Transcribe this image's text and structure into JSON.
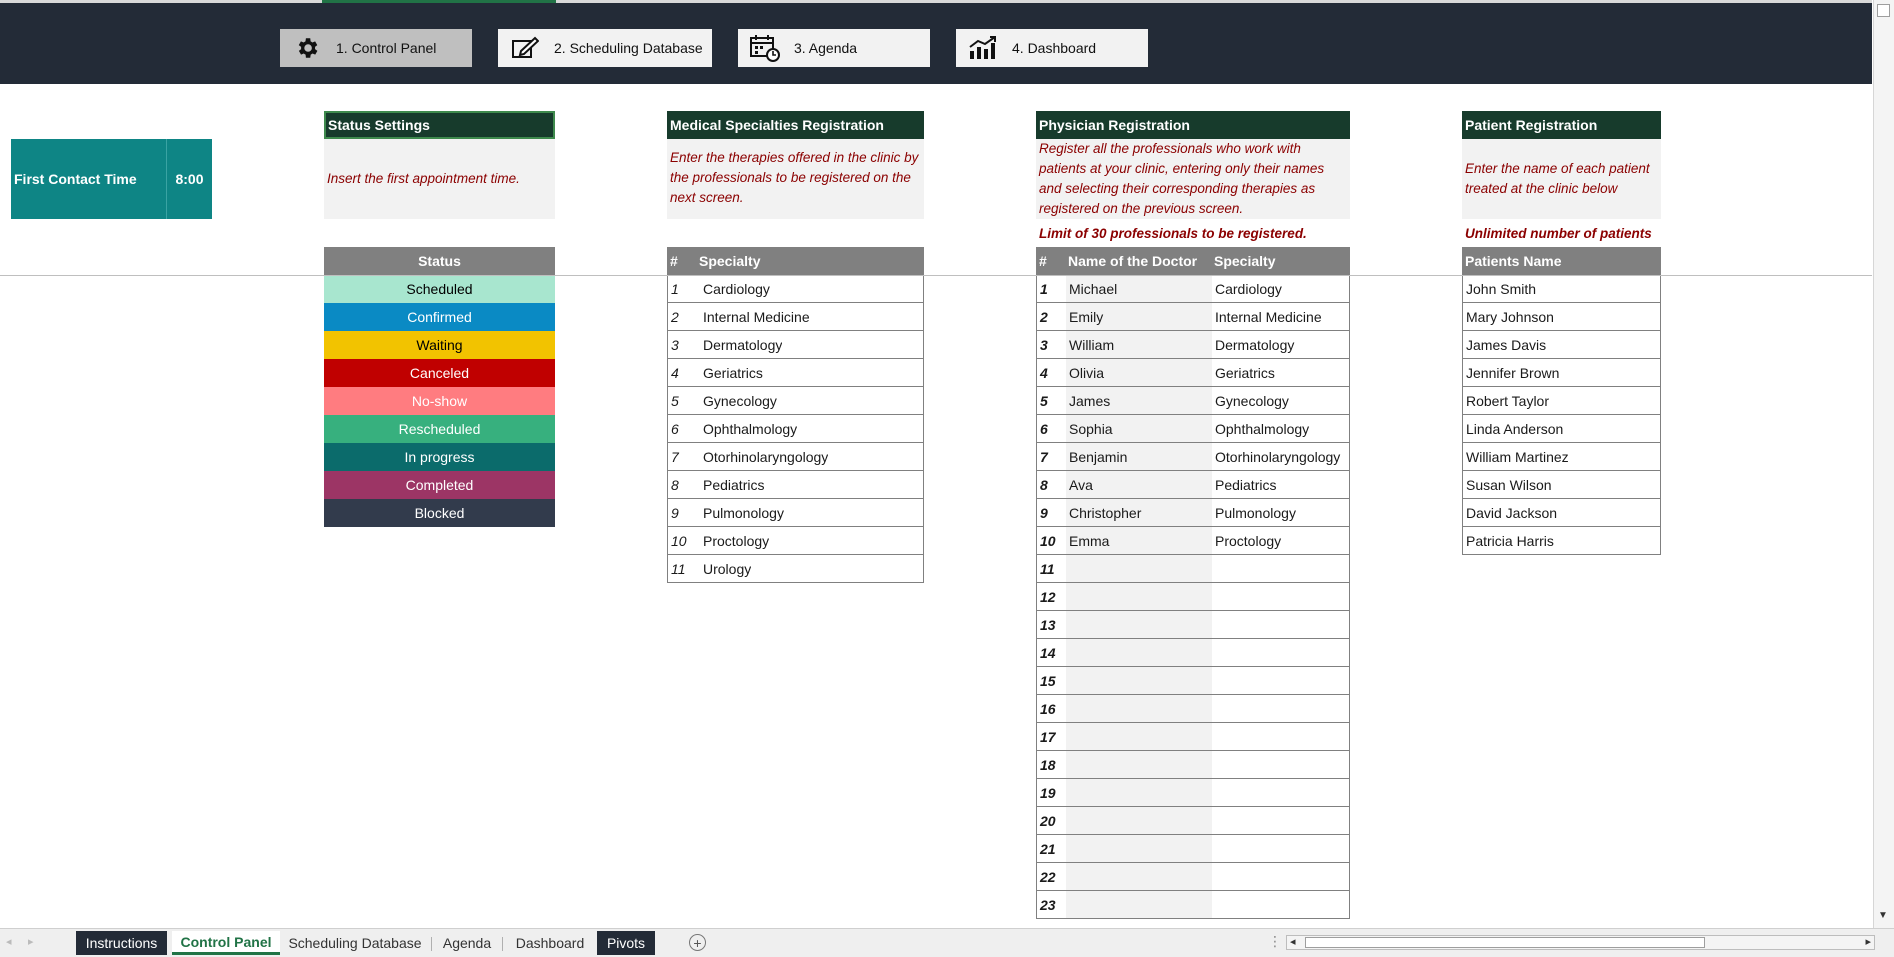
{
  "nav": {
    "buttons": [
      {
        "label": "1. Control Panel",
        "icon": "gear-icon",
        "active": true
      },
      {
        "label": "2. Scheduling Database",
        "icon": "edit-icon",
        "active": false
      },
      {
        "label": "3. Agenda",
        "icon": "calendar-clock-icon",
        "active": false
      },
      {
        "label": "4. Dashboard",
        "icon": "chart-icon",
        "active": false
      }
    ]
  },
  "first_contact": {
    "label": "First Contact Time",
    "value": "8:00"
  },
  "status_settings": {
    "title": "Status Settings",
    "description": "Insert the first appointment time.",
    "header": "Status",
    "items": [
      {
        "label": "Scheduled",
        "bg": "#a8e6cf",
        "fg": "#000000"
      },
      {
        "label": "Confirmed",
        "bg": "#0a8ac4",
        "fg": "#ffffff"
      },
      {
        "label": "Waiting",
        "bg": "#f2c300",
        "fg": "#000000"
      },
      {
        "label": "Canceled",
        "bg": "#c00000",
        "fg": "#ffffff"
      },
      {
        "label": "No-show",
        "bg": "#ff7c80",
        "fg": "#ffffff"
      },
      {
        "label": "Rescheduled",
        "bg": "#37b07e",
        "fg": "#ffffff"
      },
      {
        "label": "In progress",
        "bg": "#0b6b6b",
        "fg": "#ffffff"
      },
      {
        "label": "Completed",
        "bg": "#9c3565",
        "fg": "#ffffff"
      },
      {
        "label": "Blocked",
        "bg": "#323b4c",
        "fg": "#ffffff"
      }
    ]
  },
  "specialties": {
    "title": "Medical Specialties Registration",
    "description": "Enter the therapies offered in the clinic by the professionals to be registered on the next screen.",
    "col_num": "#",
    "col_name": "Specialty",
    "rows": [
      {
        "num": "1",
        "name": "Cardiology"
      },
      {
        "num": "2",
        "name": "Internal Medicine"
      },
      {
        "num": "3",
        "name": "Dermatology"
      },
      {
        "num": "4",
        "name": "Geriatrics"
      },
      {
        "num": "5",
        "name": "Gynecology"
      },
      {
        "num": "6",
        "name": "Ophthalmology"
      },
      {
        "num": "7",
        "name": "Otorhinolaryngology"
      },
      {
        "num": "8",
        "name": "Pediatrics"
      },
      {
        "num": "9",
        "name": "Pulmonology"
      },
      {
        "num": "10",
        "name": "Proctology"
      },
      {
        "num": "11",
        "name": "Urology"
      }
    ]
  },
  "physicians": {
    "title": "Physician Registration",
    "description": "Register all the professionals who work with patients at your clinic, entering only their names and selecting their corresponding therapies as registered on the previous screen.",
    "limit": "Limit of 30 professionals to be registered.",
    "col_num": "#",
    "col_name": "Name of the Doctor",
    "col_specialty": "Specialty",
    "rows": [
      {
        "num": "1",
        "name": "Michael",
        "specialty": "Cardiology"
      },
      {
        "num": "2",
        "name": "Emily",
        "specialty": "Internal Medicine"
      },
      {
        "num": "3",
        "name": "William",
        "specialty": "Dermatology"
      },
      {
        "num": "4",
        "name": "Olivia",
        "specialty": "Geriatrics"
      },
      {
        "num": "5",
        "name": "James",
        "specialty": "Gynecology"
      },
      {
        "num": "6",
        "name": "Sophia",
        "specialty": "Ophthalmology"
      },
      {
        "num": "7",
        "name": "Benjamin",
        "specialty": "Otorhinolaryngology"
      },
      {
        "num": "8",
        "name": "Ava",
        "specialty": "Pediatrics"
      },
      {
        "num": "9",
        "name": "Christopher",
        "specialty": "Pulmonology"
      },
      {
        "num": "10",
        "name": "Emma",
        "specialty": "Proctology"
      },
      {
        "num": "11",
        "name": "",
        "specialty": ""
      },
      {
        "num": "12",
        "name": "",
        "specialty": ""
      },
      {
        "num": "13",
        "name": "",
        "specialty": ""
      },
      {
        "num": "14",
        "name": "",
        "specialty": ""
      },
      {
        "num": "15",
        "name": "",
        "specialty": ""
      },
      {
        "num": "16",
        "name": "",
        "specialty": ""
      },
      {
        "num": "17",
        "name": "",
        "specialty": ""
      },
      {
        "num": "18",
        "name": "",
        "specialty": ""
      },
      {
        "num": "19",
        "name": "",
        "specialty": ""
      },
      {
        "num": "20",
        "name": "",
        "specialty": ""
      },
      {
        "num": "21",
        "name": "",
        "specialty": ""
      },
      {
        "num": "22",
        "name": "",
        "specialty": ""
      },
      {
        "num": "23",
        "name": "",
        "specialty": ""
      }
    ]
  },
  "patients": {
    "title": "Patient Registration",
    "description": "Enter the name of each patient treated at the clinic below",
    "limit": "Unlimited number of patients",
    "col_name": "Patients Name",
    "rows": [
      "John Smith",
      "Mary Johnson",
      "James Davis",
      "Jennifer Brown",
      "Robert Taylor",
      "Linda Anderson",
      "William Martinez",
      "Susan Wilson",
      "David Jackson",
      "Patricia Harris"
    ]
  },
  "sheet_tabs": [
    {
      "label": "Instructions",
      "style": "dark"
    },
    {
      "label": "Control Panel",
      "style": "active"
    },
    {
      "label": "Scheduling Database",
      "style": "normal"
    },
    {
      "label": "Agenda",
      "style": "normal"
    },
    {
      "label": "Dashboard",
      "style": "normal"
    },
    {
      "label": "Pivots",
      "style": "dark"
    }
  ],
  "colors": {
    "navbar": "#232b37",
    "section_header": "#173b2c",
    "teal": "#0e8585",
    "table_header": "#808080",
    "italic_red": "#8b0000",
    "excel_green": "#217346"
  }
}
